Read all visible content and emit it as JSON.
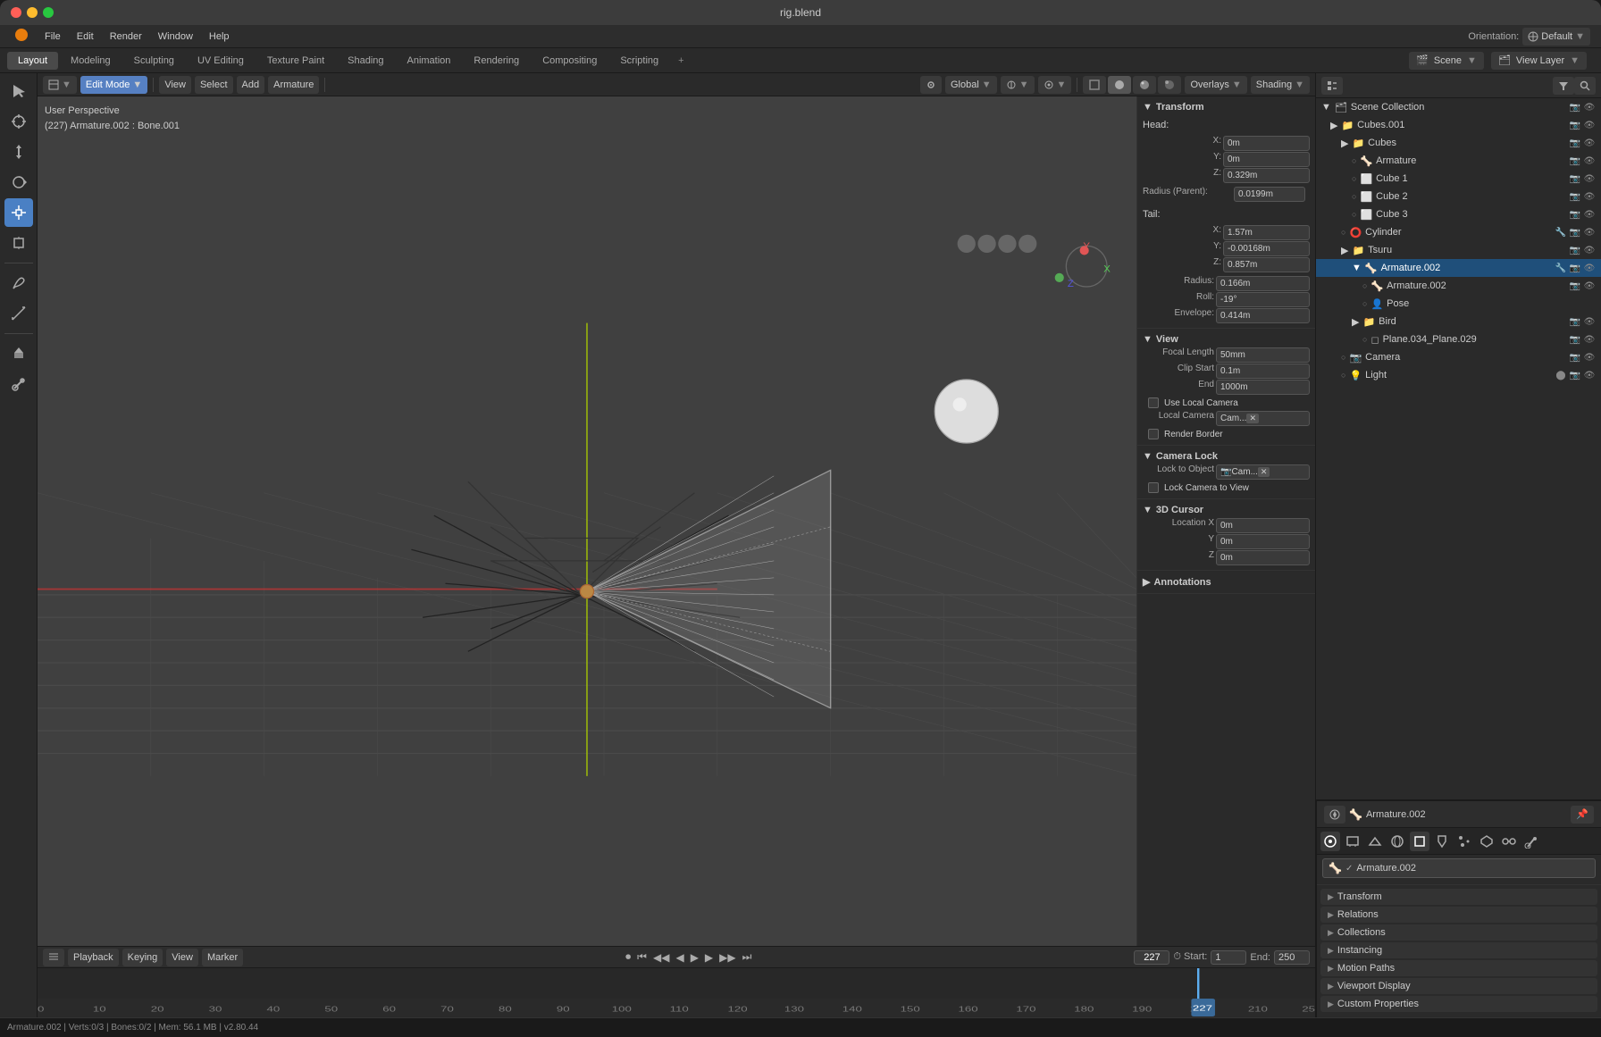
{
  "window": {
    "title": "rig.blend",
    "titlebar_buttons": [
      "close",
      "minimize",
      "maximize"
    ]
  },
  "menu": {
    "items": [
      "Blender",
      "File",
      "Edit",
      "Render",
      "Window",
      "Help"
    ]
  },
  "tabs": {
    "items": [
      "Layout",
      "Modeling",
      "Sculpting",
      "UV Editing",
      "Texture Paint",
      "Shading",
      "Animation",
      "Rendering",
      "Compositing",
      "Scripting"
    ],
    "active": "Layout"
  },
  "top_right": {
    "scene_icon": "🎬",
    "scene_name": "Scene",
    "view_layer_icon": "📷",
    "view_layer_name": "View Layer"
  },
  "viewport_toolbar": {
    "mode": "Edit Mode",
    "mode_icon": "✏",
    "view": "View",
    "select": "Select",
    "add": "Add",
    "armature": "Armature",
    "pivot": "Global",
    "overlays": "Overlays",
    "shading": "Shading"
  },
  "viewport_info": {
    "perspective": "User Perspective",
    "selection": "(227) Armature.002 : Bone.001"
  },
  "orientation": {
    "label": "Orientation:",
    "value": "Default"
  },
  "n_panel": {
    "transform_section": {
      "title": "Transform",
      "head_label": "Head:",
      "head_x": "0m",
      "head_y": "0m",
      "head_z": "0.329m",
      "radius_parent_label": "Radius (Parent):",
      "radius_parent_value": "0.0199m",
      "tail_label": "Tail:",
      "tail_x": "1.57m",
      "tail_y": "-0.00168m",
      "tail_z": "0.857m",
      "radius_label": "Radius:",
      "radius_value": "0.166m",
      "roll_label": "Roll:",
      "roll_value": "-19°",
      "envelope_label": "Envelope:",
      "envelope_value": "0.414m"
    },
    "view_section": {
      "title": "View",
      "focal_length_label": "Focal Length",
      "focal_length_value": "50mm",
      "clip_start_label": "Clip Start",
      "clip_start_value": "0.1m",
      "clip_end_label": "End",
      "clip_end_value": "1000m",
      "use_local_camera_label": "Use Local Camera",
      "local_camera_label": "Local Camera",
      "local_camera_value": "Cam...",
      "render_border_label": "Render Border"
    },
    "camera_lock_section": {
      "title": "Camera Lock",
      "lock_to_object_label": "Lock to Object",
      "lock_to_object_value": "Cam...",
      "lock_camera_to_view_label": "Lock Camera to View"
    },
    "cursor_section": {
      "title": "3D Cursor",
      "location_x_label": "Location X",
      "location_x_value": "0m",
      "location_y_label": "Y",
      "location_y_value": "0m",
      "location_z_label": "Z",
      "location_z_value": "0m"
    },
    "annotations_section": {
      "title": "Annotations"
    }
  },
  "properties_panel": {
    "header_object": "Armature.002",
    "header_object_icon": "🦴",
    "data_name": "Armature.002",
    "sections": {
      "transform": "Transform",
      "relations": "Relations",
      "collections": "Collections",
      "instancing": "Instancing",
      "motion_paths": "Motion Paths",
      "viewport_display": "Viewport Display",
      "custom_properties": "Custom Properties"
    }
  },
  "scene_outline": {
    "title": "Scene Collection",
    "items": [
      {
        "label": "Cubes.001",
        "level": 1,
        "icon": "📦",
        "type": "collection"
      },
      {
        "label": "Cubes",
        "level": 2,
        "icon": "📦",
        "type": "collection"
      },
      {
        "label": "Armature",
        "level": 3,
        "icon": "🦴",
        "type": "object"
      },
      {
        "label": "Cube 1",
        "level": 3,
        "icon": "⬜",
        "type": "object"
      },
      {
        "label": "Cube 2",
        "level": 3,
        "icon": "⬜",
        "type": "object"
      },
      {
        "label": "Cube 3",
        "level": 3,
        "icon": "⬜",
        "type": "object"
      },
      {
        "label": "Cylinder",
        "level": 2,
        "icon": "⭕",
        "type": "object"
      },
      {
        "label": "Tsuru",
        "level": 2,
        "icon": "📦",
        "type": "collection"
      },
      {
        "label": "Armature.002",
        "level": 3,
        "icon": "🦴",
        "type": "object",
        "selected": true
      },
      {
        "label": "Armature.002",
        "level": 4,
        "icon": "🦴",
        "type": "data"
      },
      {
        "label": "Pose",
        "level": 4,
        "icon": "👤",
        "type": "pose"
      },
      {
        "label": "Bird",
        "level": 3,
        "icon": "📦",
        "type": "collection"
      },
      {
        "label": "Plane.034_Plane.029",
        "level": 4,
        "icon": "◻",
        "type": "object"
      },
      {
        "label": "Camera",
        "level": 2,
        "icon": "📷",
        "type": "object"
      },
      {
        "label": "Light",
        "level": 2,
        "icon": "💡",
        "type": "object"
      }
    ]
  },
  "timeline": {
    "playback": "Playback",
    "keying": "Keying",
    "view": "View",
    "marker": "Marker",
    "current_frame": "227",
    "start_frame": "1",
    "end_frame": "250",
    "frame_highlight": "227"
  },
  "left_tools": {
    "icons": [
      "cursor",
      "move",
      "rotate",
      "scale",
      "transform",
      "annotate",
      "measure",
      "add_cube",
      "extrude",
      "edit_bone"
    ]
  },
  "status_bar": {
    "text": "Armature.002 | Verts:0/3 | Bones:0/2 | Mem: 56.1 MB | v2.80.44"
  }
}
